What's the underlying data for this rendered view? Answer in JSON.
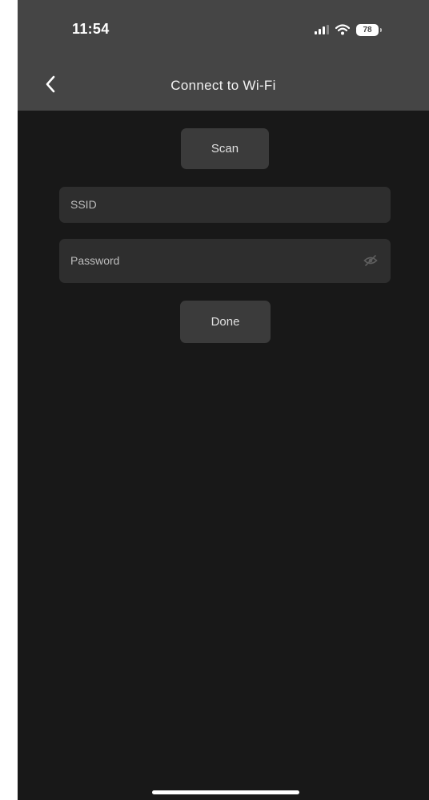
{
  "status_bar": {
    "time": "11:54",
    "battery": "78",
    "icons": [
      "signal-icon",
      "wifi-icon",
      "battery-icon"
    ]
  },
  "header": {
    "title": "Connect to Wi-Fi",
    "back_icon": "chevron-left-icon"
  },
  "form": {
    "scan_label": "Scan",
    "ssid_placeholder": "SSID",
    "password_placeholder": "Password",
    "password_toggle_icon": "eye-slash-icon",
    "done_label": "Done"
  },
  "colors": {
    "header_bg": "#454545",
    "screen_bg": "#181818",
    "button_bg": "#3b3b3b",
    "field_bg": "#2e2e2e"
  }
}
